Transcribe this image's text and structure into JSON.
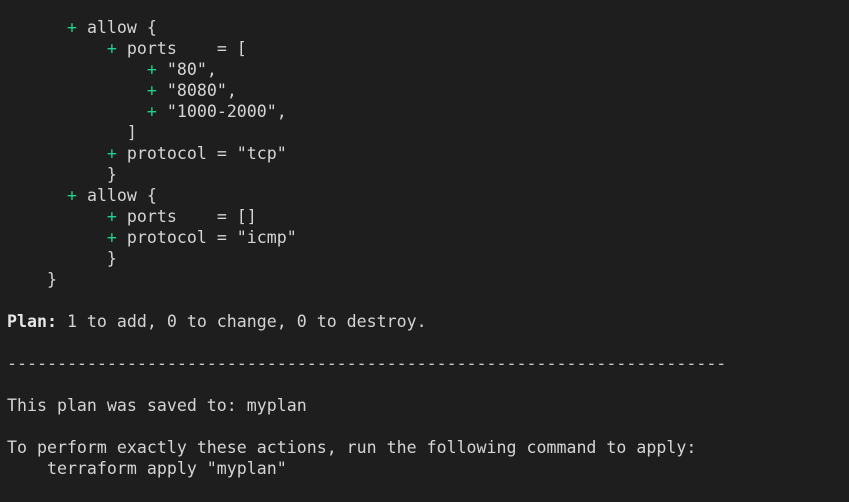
{
  "terminal": {
    "plus_sign": "+",
    "lines": [
      {
        "indent": "    ",
        "text": "allow {"
      },
      {
        "indent": "        ",
        "text": "ports    = ["
      },
      {
        "indent": "            ",
        "text": "\"80\","
      },
      {
        "indent": "            ",
        "text": "\"8080\","
      },
      {
        "indent": "            ",
        "text": "\"1000-2000\","
      },
      {
        "indent": "          ",
        "text": "]"
      },
      {
        "indent": "        ",
        "text": "protocol = \"tcp\""
      },
      {
        "indent": "        ",
        "text": "}"
      },
      {
        "indent": "    ",
        "text": "allow {"
      },
      {
        "indent": "        ",
        "text": "ports    = []"
      },
      {
        "indent": "        ",
        "text": "protocol = \"icmp\""
      },
      {
        "indent": "        ",
        "text": "}"
      },
      {
        "indent": "    ",
        "text": "}"
      }
    ],
    "plan_label": "Plan:",
    "plan_summary": " 1 to add, 0 to change, 0 to destroy.",
    "separator": "------------------------------------------------------------------------",
    "saved_message": "This plan was saved to: myplan",
    "apply_instruction": "To perform exactly these actions, run the following command to apply:",
    "apply_command": "    terraform apply \"myplan\""
  },
  "colors": {
    "background": "#1e1e1e",
    "text": "#d4d4d4",
    "plus": "#23d18b"
  }
}
